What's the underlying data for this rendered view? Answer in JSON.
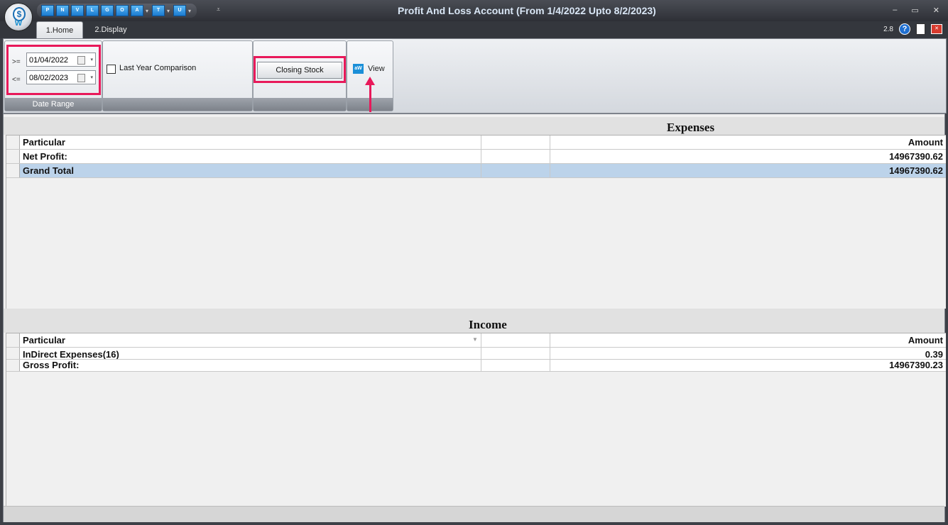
{
  "window": {
    "title": "Profit And Loss Account (From 1/4/2022 Upto 8/2/2023)",
    "version": "2.8"
  },
  "qat": {
    "buttons": [
      "P",
      "N",
      "V",
      "L",
      "G",
      "O",
      "A",
      "T",
      "U"
    ]
  },
  "tabs": [
    {
      "label": "1.Home"
    },
    {
      "label": "2.Display"
    }
  ],
  "ribbon": {
    "date_range": {
      "from_op": ">=",
      "from_value": "01/04/2022",
      "to_op": "<=",
      "to_value": "08/02/2023",
      "label": "Date Range"
    },
    "last_year_comparison": {
      "label": "Last Year Comparison",
      "checked": false
    },
    "closing_stock_label": "Closing Stock",
    "view_label": "View"
  },
  "expenses": {
    "title": "Expenses",
    "columns": {
      "particular": "Particular",
      "amount": "Amount"
    },
    "rows": [
      {
        "particular": "Net Profit:",
        "amount": "14967390.62"
      },
      {
        "particular": "Grand Total",
        "amount": "14967390.62"
      }
    ]
  },
  "income": {
    "title": "Income",
    "columns": {
      "particular": "Particular",
      "amount": "Amount"
    },
    "rows": [
      {
        "particular": "InDirect Expenses(16)",
        "amount": "0.39"
      },
      {
        "particular": "Gross Profit:",
        "amount": "14967390.23"
      }
    ]
  },
  "colors": {
    "highlight": "#e8195a",
    "selected_row": "#bcd3ea",
    "title_text": "#d9e6f5"
  }
}
